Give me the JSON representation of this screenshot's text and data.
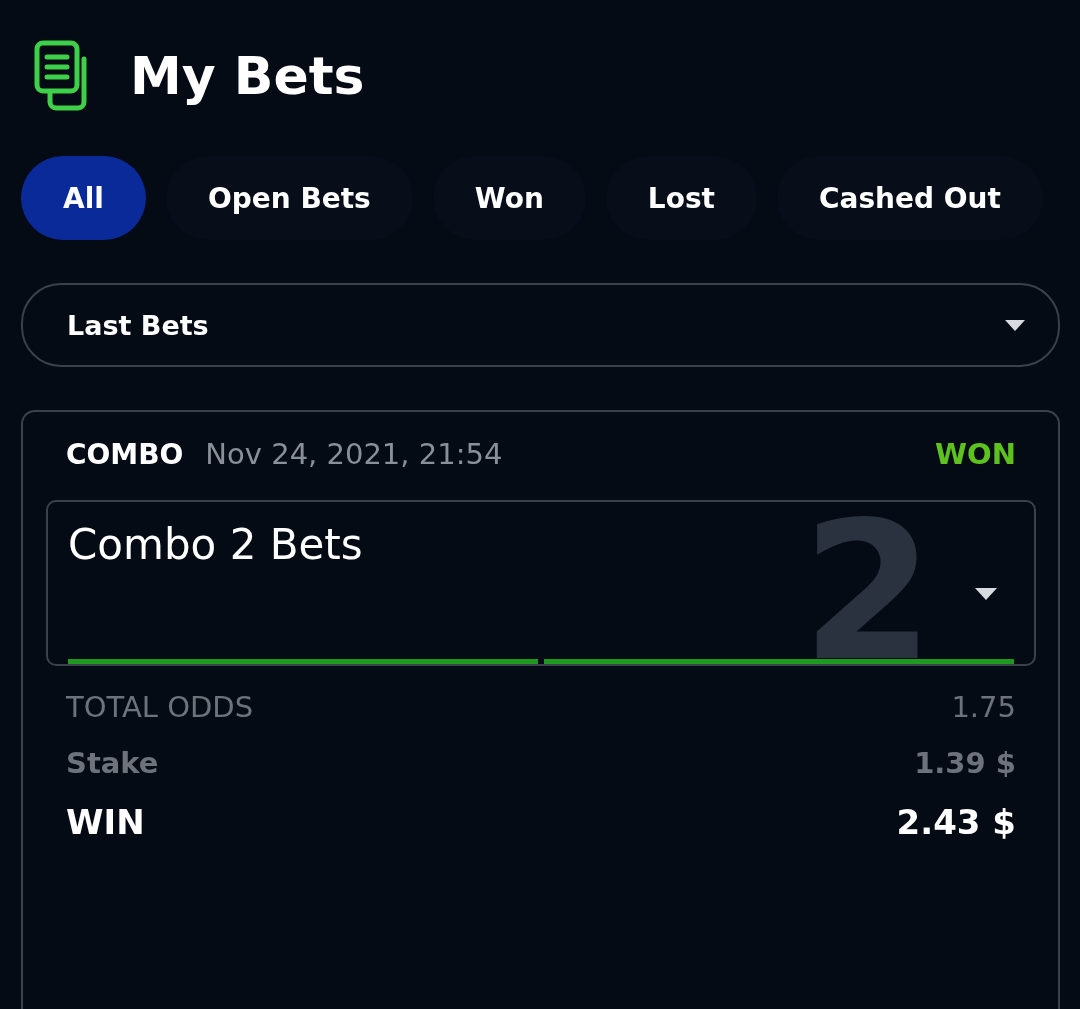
{
  "header": {
    "title": "My Bets"
  },
  "tabs": [
    {
      "label": "All",
      "selected": true
    },
    {
      "label": "Open Bets",
      "selected": false
    },
    {
      "label": "Won",
      "selected": false
    },
    {
      "label": "Lost",
      "selected": false
    },
    {
      "label": "Cashed Out",
      "selected": false
    }
  ],
  "filter": {
    "value": "Last Bets"
  },
  "bet": {
    "type": "COMBO",
    "date": "Nov 24, 2021, 21:54",
    "status": "WON",
    "title": "Combo 2 Bets",
    "count": "2",
    "expanded": false,
    "legs": [
      {
        "won": true
      },
      {
        "won": true
      }
    ],
    "rows": [
      {
        "kind": "odds",
        "label": "TOTAL ODDS",
        "value": "1.75"
      },
      {
        "kind": "stake",
        "label": "Stake",
        "value": "1.39 $"
      },
      {
        "kind": "win",
        "label": "WIN",
        "value": "2.43 $"
      }
    ]
  }
}
